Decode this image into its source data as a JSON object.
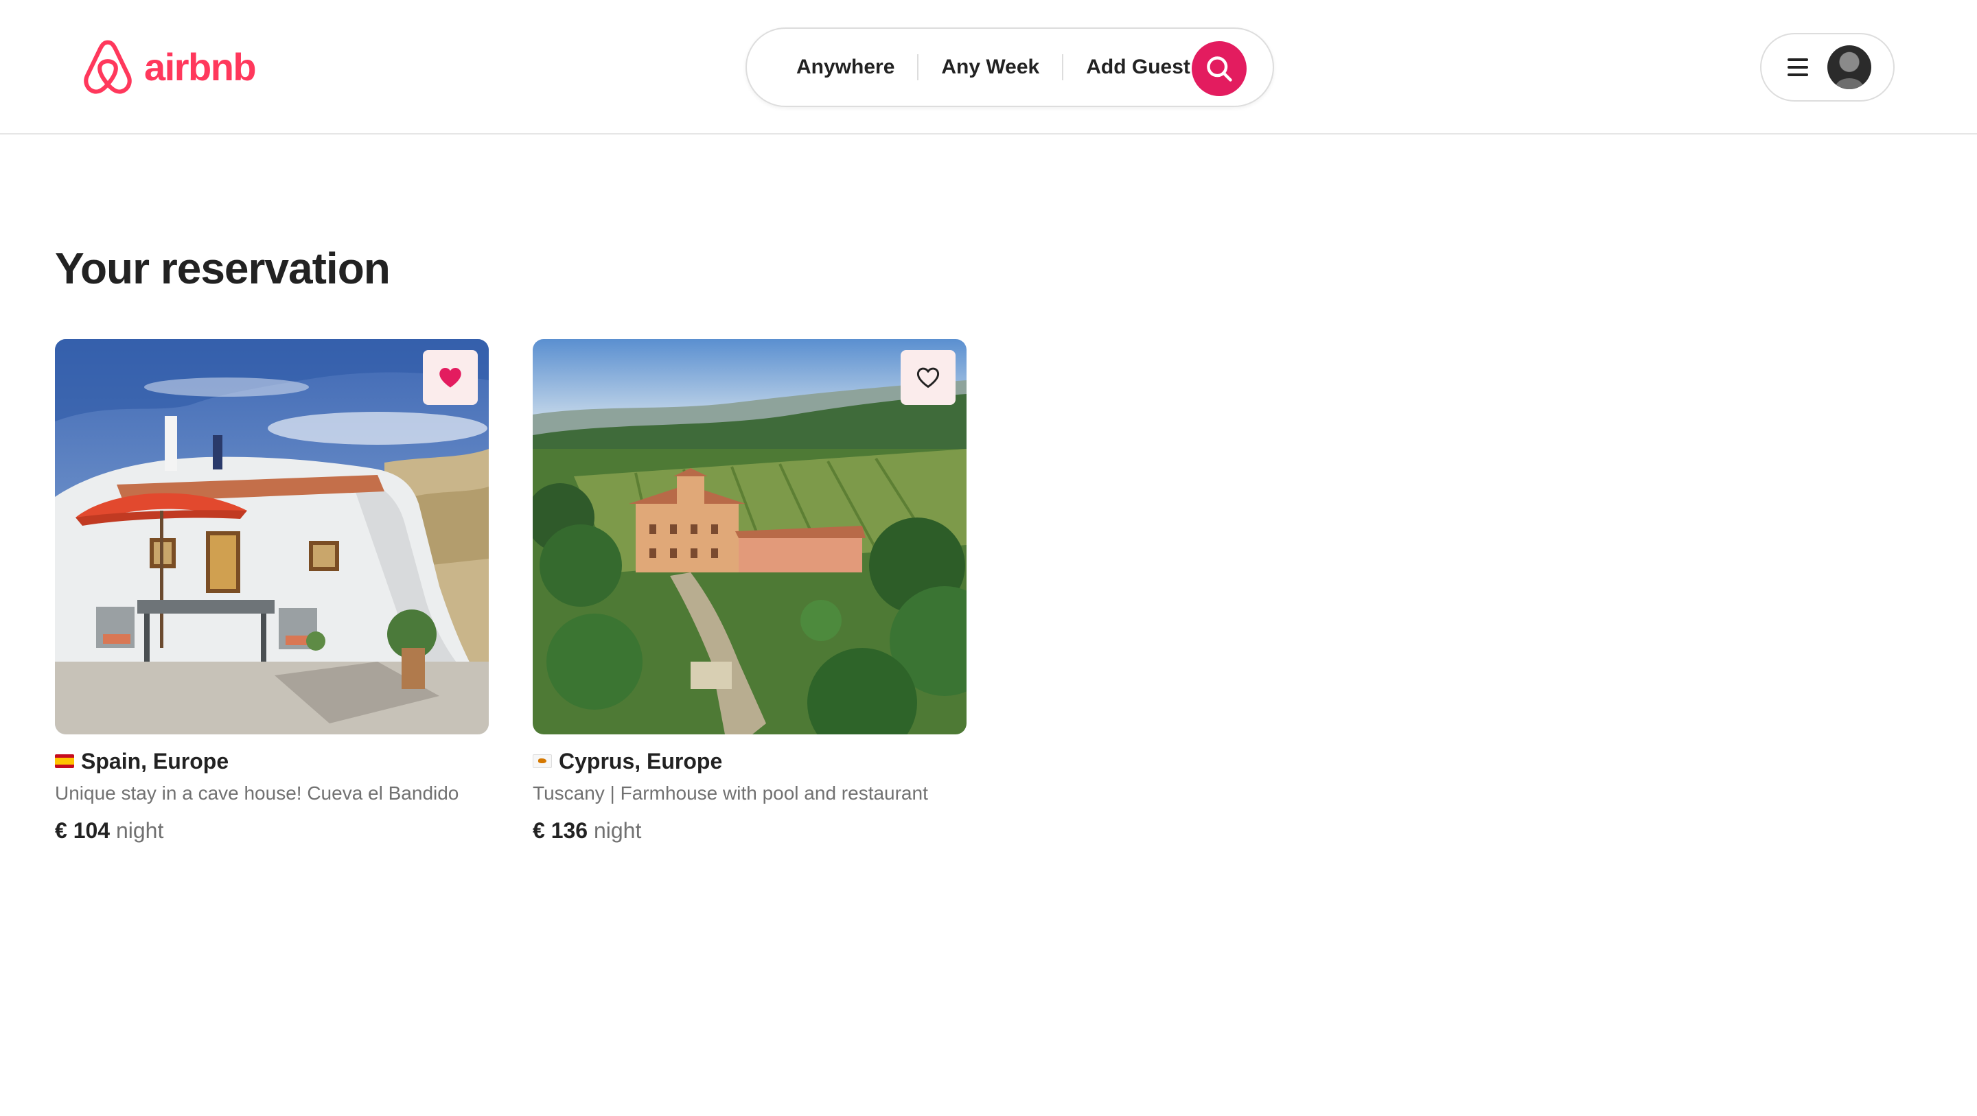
{
  "header": {
    "logo_text": "airbnb",
    "brand_color": "#ff385c",
    "search": {
      "where": "Anywhere",
      "when": "Any Week",
      "who": "Add Guest",
      "button_icon": "search-icon",
      "button_color": "#e31c5f"
    },
    "user_menu": {
      "menu_icon": "hamburger-menu-icon",
      "avatar_icon": "user-avatar"
    }
  },
  "main": {
    "title": "Your reservation",
    "listings": [
      {
        "flag": "spain-flag-icon",
        "location": "Spain, Europe",
        "description": "Unique stay in a cave house! Cueva el Bandido",
        "price": "€ 104",
        "price_unit": "night",
        "favorited": true,
        "favorite_icon": "heart-filled-icon"
      },
      {
        "flag": "cyprus-flag-icon",
        "location": "Cyprus, Europe",
        "description": "Tuscany | Farmhouse with pool and restaurant",
        "price": "€ 136",
        "price_unit": "night",
        "favorited": false,
        "favorite_icon": "heart-outline-icon"
      }
    ]
  }
}
